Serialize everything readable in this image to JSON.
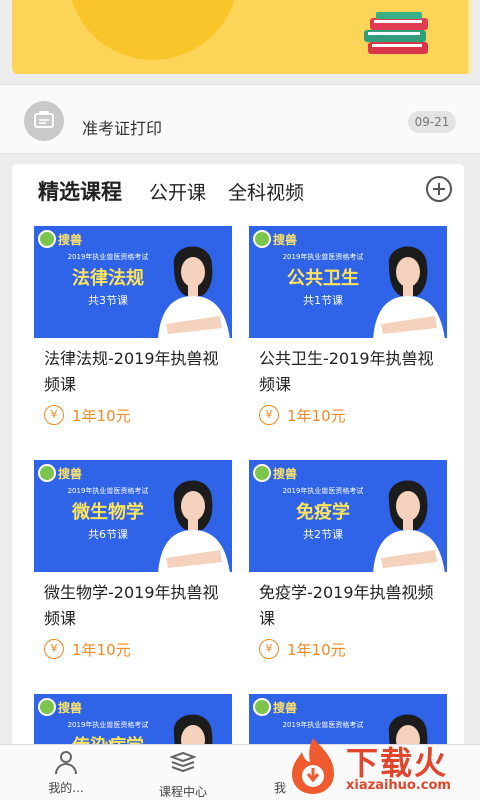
{
  "notice": {
    "text": "准考证打印",
    "date": "09-21"
  },
  "tabs": [
    {
      "label": "精选课程"
    },
    {
      "label": "公开课"
    },
    {
      "label": "全科视频"
    }
  ],
  "courses": [
    {
      "logo": "搜兽",
      "thumb_sub": "2019年执业兽医资格考试",
      "thumb_title": "法律法规",
      "thumb_count": "共3节课",
      "name": "法律法规-2019年执兽视频课",
      "price": "1年10元"
    },
    {
      "logo": "搜兽",
      "thumb_sub": "2019年执业兽医资格考试",
      "thumb_title": "公共卫生",
      "thumb_count": "共1节课",
      "name": "公共卫生-2019年执兽视频课",
      "price": "1年10元"
    },
    {
      "logo": "搜兽",
      "thumb_sub": "2019年执业兽医资格考试",
      "thumb_title": "微生物学",
      "thumb_count": "共6节课",
      "name": "微生物学-2019年执兽视频课",
      "price": "1年10元"
    },
    {
      "logo": "搜兽",
      "thumb_sub": "2019年执业兽医资格考试",
      "thumb_title": "免疫学",
      "thumb_count": "共2节课",
      "name": "免疫学-2019年执兽视频课",
      "price": "1年10元"
    },
    {
      "logo": "搜兽",
      "thumb_sub": "2019年执业兽医资格考试",
      "thumb_title": "传染病学"
    },
    {
      "logo": "搜兽",
      "thumb_sub": "2019年执业兽医资格考试"
    }
  ],
  "price_symbol": "¥",
  "tabbar": [
    {
      "label": "我的..."
    },
    {
      "label": "课程中心"
    },
    {
      "label": "我"
    }
  ],
  "watermark": {
    "text": "下载火",
    "url": "xiazaihuo.com"
  },
  "colors": {
    "banner": "#fcd457",
    "thumb_bg": "#2f63e8",
    "price": "#f08a24",
    "thumb_title": "#ffe45c"
  }
}
